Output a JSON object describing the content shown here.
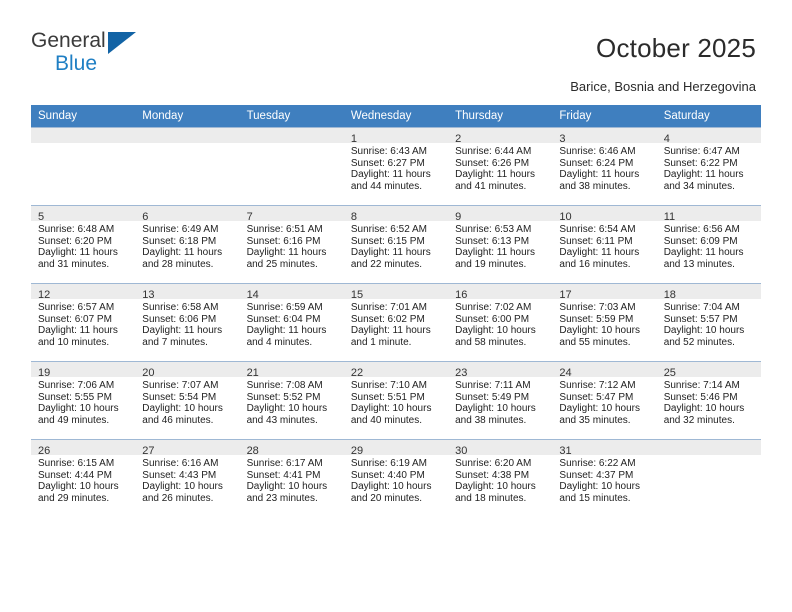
{
  "brand": {
    "name_top": "General",
    "name_bottom": "Blue",
    "triangle_color": "#1263a5",
    "blue_color": "#1f7fc4"
  },
  "header": {
    "title": "October 2025",
    "subtitle": "Barice, Bosnia and Herzegovina",
    "header_bg": "#3f7fbf",
    "daynum_bg": "#ececec"
  },
  "calendar": {
    "weekday_headers": [
      "Sunday",
      "Monday",
      "Tuesday",
      "Wednesday",
      "Thursday",
      "Friday",
      "Saturday"
    ],
    "weeks": [
      [
        {
          "day": "",
          "sunrise": "",
          "sunset": "",
          "daylight": "",
          "empty": true
        },
        {
          "day": "",
          "sunrise": "",
          "sunset": "",
          "daylight": "",
          "empty": true
        },
        {
          "day": "",
          "sunrise": "",
          "sunset": "",
          "daylight": "",
          "empty": true
        },
        {
          "day": "1",
          "sunrise": "Sunrise: 6:43 AM",
          "sunset": "Sunset: 6:27 PM",
          "daylight": "Daylight: 11 hours and 44 minutes."
        },
        {
          "day": "2",
          "sunrise": "Sunrise: 6:44 AM",
          "sunset": "Sunset: 6:26 PM",
          "daylight": "Daylight: 11 hours and 41 minutes."
        },
        {
          "day": "3",
          "sunrise": "Sunrise: 6:46 AM",
          "sunset": "Sunset: 6:24 PM",
          "daylight": "Daylight: 11 hours and 38 minutes."
        },
        {
          "day": "4",
          "sunrise": "Sunrise: 6:47 AM",
          "sunset": "Sunset: 6:22 PM",
          "daylight": "Daylight: 11 hours and 34 minutes."
        }
      ],
      [
        {
          "day": "5",
          "sunrise": "Sunrise: 6:48 AM",
          "sunset": "Sunset: 6:20 PM",
          "daylight": "Daylight: 11 hours and 31 minutes."
        },
        {
          "day": "6",
          "sunrise": "Sunrise: 6:49 AM",
          "sunset": "Sunset: 6:18 PM",
          "daylight": "Daylight: 11 hours and 28 minutes."
        },
        {
          "day": "7",
          "sunrise": "Sunrise: 6:51 AM",
          "sunset": "Sunset: 6:16 PM",
          "daylight": "Daylight: 11 hours and 25 minutes."
        },
        {
          "day": "8",
          "sunrise": "Sunrise: 6:52 AM",
          "sunset": "Sunset: 6:15 PM",
          "daylight": "Daylight: 11 hours and 22 minutes."
        },
        {
          "day": "9",
          "sunrise": "Sunrise: 6:53 AM",
          "sunset": "Sunset: 6:13 PM",
          "daylight": "Daylight: 11 hours and 19 minutes."
        },
        {
          "day": "10",
          "sunrise": "Sunrise: 6:54 AM",
          "sunset": "Sunset: 6:11 PM",
          "daylight": "Daylight: 11 hours and 16 minutes."
        },
        {
          "day": "11",
          "sunrise": "Sunrise: 6:56 AM",
          "sunset": "Sunset: 6:09 PM",
          "daylight": "Daylight: 11 hours and 13 minutes."
        }
      ],
      [
        {
          "day": "12",
          "sunrise": "Sunrise: 6:57 AM",
          "sunset": "Sunset: 6:07 PM",
          "daylight": "Daylight: 11 hours and 10 minutes."
        },
        {
          "day": "13",
          "sunrise": "Sunrise: 6:58 AM",
          "sunset": "Sunset: 6:06 PM",
          "daylight": "Daylight: 11 hours and 7 minutes."
        },
        {
          "day": "14",
          "sunrise": "Sunrise: 6:59 AM",
          "sunset": "Sunset: 6:04 PM",
          "daylight": "Daylight: 11 hours and 4 minutes."
        },
        {
          "day": "15",
          "sunrise": "Sunrise: 7:01 AM",
          "sunset": "Sunset: 6:02 PM",
          "daylight": "Daylight: 11 hours and 1 minute."
        },
        {
          "day": "16",
          "sunrise": "Sunrise: 7:02 AM",
          "sunset": "Sunset: 6:00 PM",
          "daylight": "Daylight: 10 hours and 58 minutes."
        },
        {
          "day": "17",
          "sunrise": "Sunrise: 7:03 AM",
          "sunset": "Sunset: 5:59 PM",
          "daylight": "Daylight: 10 hours and 55 minutes."
        },
        {
          "day": "18",
          "sunrise": "Sunrise: 7:04 AM",
          "sunset": "Sunset: 5:57 PM",
          "daylight": "Daylight: 10 hours and 52 minutes."
        }
      ],
      [
        {
          "day": "19",
          "sunrise": "Sunrise: 7:06 AM",
          "sunset": "Sunset: 5:55 PM",
          "daylight": "Daylight: 10 hours and 49 minutes."
        },
        {
          "day": "20",
          "sunrise": "Sunrise: 7:07 AM",
          "sunset": "Sunset: 5:54 PM",
          "daylight": "Daylight: 10 hours and 46 minutes."
        },
        {
          "day": "21",
          "sunrise": "Sunrise: 7:08 AM",
          "sunset": "Sunset: 5:52 PM",
          "daylight": "Daylight: 10 hours and 43 minutes."
        },
        {
          "day": "22",
          "sunrise": "Sunrise: 7:10 AM",
          "sunset": "Sunset: 5:51 PM",
          "daylight": "Daylight: 10 hours and 40 minutes."
        },
        {
          "day": "23",
          "sunrise": "Sunrise: 7:11 AM",
          "sunset": "Sunset: 5:49 PM",
          "daylight": "Daylight: 10 hours and 38 minutes."
        },
        {
          "day": "24",
          "sunrise": "Sunrise: 7:12 AM",
          "sunset": "Sunset: 5:47 PM",
          "daylight": "Daylight: 10 hours and 35 minutes."
        },
        {
          "day": "25",
          "sunrise": "Sunrise: 7:14 AM",
          "sunset": "Sunset: 5:46 PM",
          "daylight": "Daylight: 10 hours and 32 minutes."
        }
      ],
      [
        {
          "day": "26",
          "sunrise": "Sunrise: 6:15 AM",
          "sunset": "Sunset: 4:44 PM",
          "daylight": "Daylight: 10 hours and 29 minutes."
        },
        {
          "day": "27",
          "sunrise": "Sunrise: 6:16 AM",
          "sunset": "Sunset: 4:43 PM",
          "daylight": "Daylight: 10 hours and 26 minutes."
        },
        {
          "day": "28",
          "sunrise": "Sunrise: 6:17 AM",
          "sunset": "Sunset: 4:41 PM",
          "daylight": "Daylight: 10 hours and 23 minutes."
        },
        {
          "day": "29",
          "sunrise": "Sunrise: 6:19 AM",
          "sunset": "Sunset: 4:40 PM",
          "daylight": "Daylight: 10 hours and 20 minutes."
        },
        {
          "day": "30",
          "sunrise": "Sunrise: 6:20 AM",
          "sunset": "Sunset: 4:38 PM",
          "daylight": "Daylight: 10 hours and 18 minutes."
        },
        {
          "day": "31",
          "sunrise": "Sunrise: 6:22 AM",
          "sunset": "Sunset: 4:37 PM",
          "daylight": "Daylight: 10 hours and 15 minutes."
        },
        {
          "day": "",
          "sunrise": "",
          "sunset": "",
          "daylight": "",
          "empty": true
        }
      ]
    ]
  }
}
